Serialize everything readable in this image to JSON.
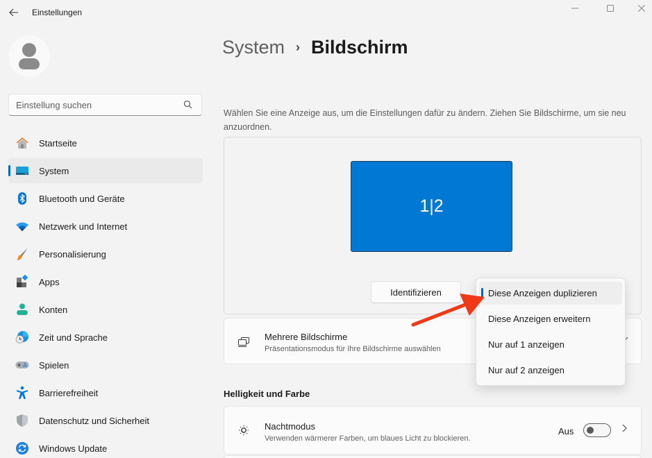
{
  "window": {
    "title": "Einstellungen",
    "back_icon": "arrow-left-icon",
    "controls": {
      "minimize": "minimize-icon",
      "maximize": "maximize-icon",
      "close": "close-icon"
    }
  },
  "sidebar": {
    "search": {
      "placeholder": "Einstellung suchen",
      "value": "",
      "icon": "search-icon"
    },
    "items": [
      {
        "label": "Startseite",
        "icon": "home-icon",
        "active": false
      },
      {
        "label": "System",
        "icon": "system-icon",
        "active": true
      },
      {
        "label": "Bluetooth und Geräte",
        "icon": "bluetooth-icon",
        "active": false
      },
      {
        "label": "Netzwerk und Internet",
        "icon": "wifi-icon",
        "active": false
      },
      {
        "label": "Personalisierung",
        "icon": "brush-icon",
        "active": false
      },
      {
        "label": "Apps",
        "icon": "apps-icon",
        "active": false
      },
      {
        "label": "Konten",
        "icon": "account-icon",
        "active": false
      },
      {
        "label": "Zeit und Sprache",
        "icon": "time-language-icon",
        "active": false
      },
      {
        "label": "Spielen",
        "icon": "gamepad-icon",
        "active": false
      },
      {
        "label": "Barrierefreiheit",
        "icon": "accessibility-icon",
        "active": false
      },
      {
        "label": "Datenschutz und Sicherheit",
        "icon": "shield-icon",
        "active": false
      },
      {
        "label": "Windows Update",
        "icon": "update-icon",
        "active": false
      }
    ]
  },
  "main": {
    "breadcrumb": {
      "parent": "System",
      "separator": "›",
      "current": "Bildschirm"
    },
    "description": "Wählen Sie eine Anzeige aus, um die Einstellungen dafür zu ändern. Ziehen Sie Bildschirme, um sie neu anzuordnen.",
    "monitor_label": "1|2",
    "identify_button": "Identifizieren",
    "multiple_displays": {
      "title": "Mehrere Bildschirme",
      "subtitle": "Präsentationsmodus für Ihre Bildschirme auswählen",
      "icon": "multiple-displays-icon"
    },
    "section_brightness": "Helligkeit und Farbe",
    "night_mode": {
      "title": "Nachtmodus",
      "subtitle": "Verwenden wärmerer Farben, um blaues Licht zu blockieren.",
      "state": "Aus",
      "enabled": false,
      "icon": "night-light-icon"
    }
  },
  "dropdown": {
    "options": [
      {
        "label": "Diese Anzeigen duplizieren",
        "selected": true
      },
      {
        "label": "Diese Anzeigen erweitern",
        "selected": false
      },
      {
        "label": "Nur auf 1 anzeigen",
        "selected": false
      },
      {
        "label": "Nur auf 2 anzeigen",
        "selected": false
      }
    ]
  },
  "colors": {
    "accent": "#0067c0",
    "monitor": "#0078d4",
    "annotation_arrow": "#f03a17",
    "background": "#f3f3f3"
  }
}
